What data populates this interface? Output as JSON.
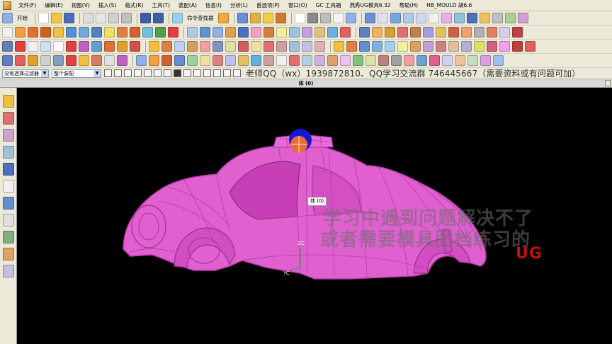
{
  "menu": [
    "文件(F)",
    "编辑(E)",
    "视图(V)",
    "插入(S)",
    "格式(R)",
    "工具(T)",
    "装配(A)",
    "信息(I)",
    "分析(L)",
    "首选项(P)",
    "窗口(O)",
    "GC 工具箱",
    "燕秀UG模具6.32",
    "帮助(H)",
    "HB_MOULD 胡6.6"
  ],
  "toolbar": {
    "start_label": "开始",
    "command_finder_label": "命令查找器"
  },
  "selection": {
    "filter_value": "没有选择过滤器",
    "scope_value": "整个装配"
  },
  "notice_text": "老师QQ（wx）1939872810、QQ学习交流群 746445667（需要资料或有问题可加）",
  "view": {
    "title": "体 (0)",
    "tooltip": "体 (0)",
    "axis_z": "ZC",
    "axis_y": "YC"
  },
  "watermark": {
    "line1": "学习中遇到问题解决不了",
    "line2": "或者需要模具图档练习的",
    "line3": "UG"
  },
  "colors": {
    "model": "#e060d0",
    "model_line": "#b53aa8",
    "viewport_bg": "#000000",
    "ui_bg": "#ece9d8"
  }
}
